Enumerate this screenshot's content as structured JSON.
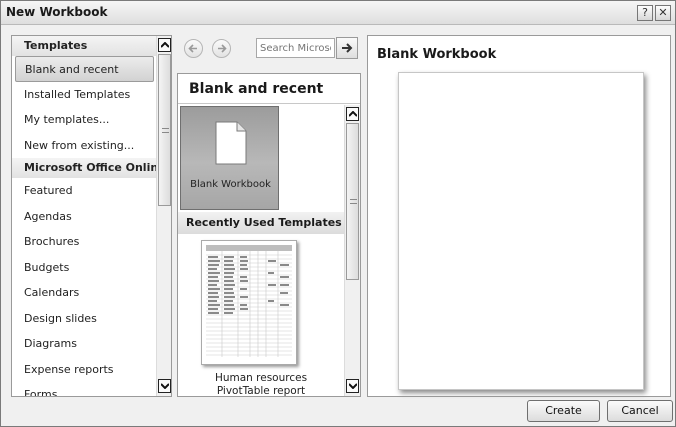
{
  "window": {
    "title": "New Workbook",
    "help_glyph": "?",
    "close_glyph": "✕"
  },
  "left_panel": {
    "items": [
      {
        "label": "Templates",
        "type": "section"
      },
      {
        "label": "Blank and recent",
        "type": "item",
        "selected": true
      },
      {
        "label": "Installed Templates",
        "type": "item"
      },
      {
        "label": "My templates...",
        "type": "item"
      },
      {
        "label": "New from existing...",
        "type": "item"
      },
      {
        "label": "Microsoft Office Online",
        "type": "section"
      },
      {
        "label": "Featured",
        "type": "item"
      },
      {
        "label": "Agendas",
        "type": "item"
      },
      {
        "label": "Brochures",
        "type": "item"
      },
      {
        "label": "Budgets",
        "type": "item"
      },
      {
        "label": "Calendars",
        "type": "item"
      },
      {
        "label": "Design slides",
        "type": "item"
      },
      {
        "label": "Diagrams",
        "type": "item"
      },
      {
        "label": "Expense reports",
        "type": "item"
      },
      {
        "label": "Forms",
        "type": "item"
      }
    ]
  },
  "middle_panel": {
    "search_placeholder": "Search Microsof",
    "heading": "Blank and recent",
    "blank_template_label": "Blank Workbook",
    "recent_heading": "Recently Used Templates",
    "recent_template_label_line1": "Human resources",
    "recent_template_label_line2": "PivotTable report"
  },
  "right_panel": {
    "preview_title": "Blank Workbook"
  },
  "footer": {
    "create_label": "Create",
    "cancel_label": "Cancel"
  }
}
